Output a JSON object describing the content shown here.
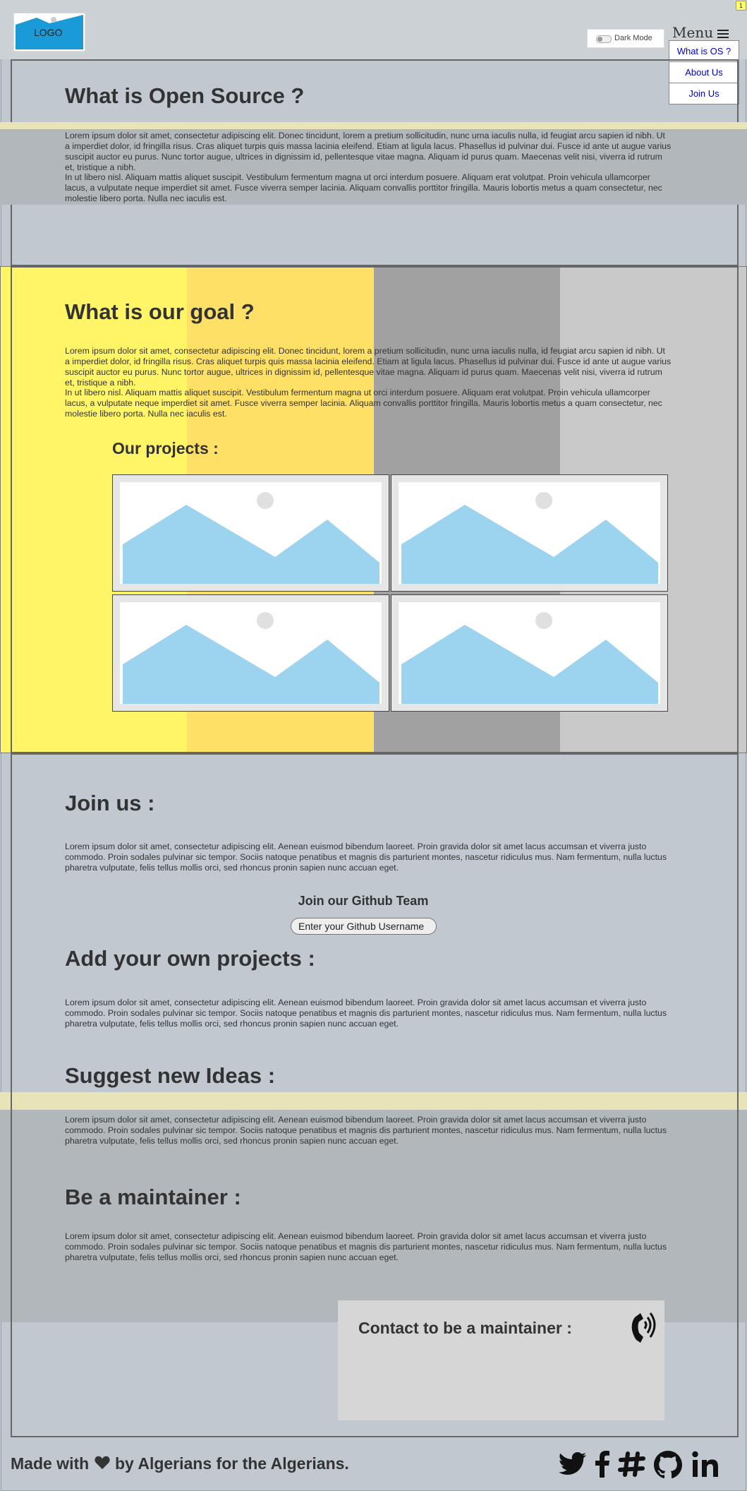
{
  "header": {
    "logo_text": "LOGO",
    "dark_mode_label": "Dark Mode",
    "menu_label": "Menu",
    "menu_items": [
      "What is OS ?",
      "About Us",
      "Join Us"
    ],
    "page_badge": "1"
  },
  "sections": {
    "what_is_os": {
      "title": "What is Open Source ?",
      "p1": "Lorem ipsum dolor sit amet, consectetur adipiscing elit. Donec tincidunt, lorem a pretium sollicitudin, nunc urna iaculis nulla, id feugiat arcu sapien id nibh. Ut a imperdiet dolor, id fringilla risus. Cras aliquet turpis quis massa lacinia eleifend. Etiam at ligula lacus. Phasellus id pulvinar dui. Fusce id ante ut augue varius suscipit auctor eu purus. Nunc tortor augue, ultrices in dignissim id, pellentesque vitae magna. Aliquam id purus quam. Maecenas velit nisi, viverra id rutrum et, tristique a nibh.",
      "p2": "In ut libero nisl. Aliquam mattis aliquet suscipit. Vestibulum fermentum magna ut orci interdum posuere. Aliquam erat volutpat. Proin vehicula ullamcorper lacus, a vulputate neque imperdiet sit amet. Fusce viverra semper lacinia. Aliquam convallis porttitor fringilla. Mauris lobortis metus a quam consectetur, nec molestie libero porta. Nulla nec iaculis est."
    },
    "goal": {
      "title": "What is our goal ?",
      "p1": "Lorem ipsum dolor sit amet, consectetur adipiscing elit. Donec tincidunt, lorem a pretium sollicitudin, nunc urna iaculis nulla, id feugiat arcu sapien id nibh. Ut a imperdiet dolor, id fringilla risus. Cras aliquet turpis quis massa lacinia eleifend. Etiam at ligula lacus. Phasellus id pulvinar dui. Fusce id ante ut augue varius suscipit auctor eu purus. Nunc tortor augue, ultrices in dignissim id, pellentesque vitae magna. Aliquam id purus quam. Maecenas velit nisi, viverra id rutrum et, tristique a nibh.",
      "p2": "In ut libero nisl. Aliquam mattis aliquet suscipit. Vestibulum fermentum magna ut orci interdum posuere. Aliquam erat volutpat. Proin vehicula ullamcorper lacus, a vulputate neque imperdiet sit amet. Fusce viverra semper lacinia. Aliquam convallis porttitor fringilla. Mauris lobortis metus a quam consectetur, nec molestie libero porta. Nulla nec iaculis est.",
      "projects_title": "Our projects :"
    },
    "join": {
      "title": "Join us :",
      "p": "Lorem ipsum dolor sit amet, consectetur adipiscing elit. Aenean euismod bibendum laoreet. Proin gravida dolor sit amet lacus accumsan et viverra justo commodo. Proin sodales pulvinar sic tempor. Sociis natoque penatibus et magnis dis parturient montes, nascetur ridiculus mus. Nam fermentum, nulla luctus pharetra vulputate, felis tellus mollis orci, sed rhoncus pronin sapien nunc accuan eget.",
      "github_title": "Join our Github Team",
      "github_placeholder": "Enter your Github Username"
    },
    "add_projects": {
      "title": "Add your own projects :",
      "p": "Lorem ipsum dolor sit amet, consectetur adipiscing elit. Aenean euismod bibendum laoreet. Proin gravida dolor sit amet lacus accumsan et viverra justo commodo. Proin sodales pulvinar sic tempor. Sociis natoque penatibus et magnis dis parturient montes, nascetur ridiculus mus. Nam fermentum, nulla luctus pharetra vulputate, felis tellus mollis orci, sed rhoncus pronin sapien nunc accuan eget."
    },
    "ideas": {
      "title": "Suggest new Ideas :",
      "p": "Lorem ipsum dolor sit amet, consectetur adipiscing elit. Aenean euismod bibendum laoreet. Proin gravida dolor sit amet lacus accumsan et viverra justo commodo. Proin sodales pulvinar sic tempor. Sociis natoque penatibus et magnis dis parturient montes, nascetur ridiculus mus. Nam fermentum, nulla luctus pharetra vulputate, felis tellus mollis orci, sed rhoncus pronin sapien nunc accuan eget."
    },
    "maintainer": {
      "title": "Be a maintainer :",
      "p": "Lorem ipsum dolor sit amet, consectetur adipiscing elit. Aenean euismod bibendum laoreet. Proin gravida dolor sit amet lacus accumsan et viverra justo commodo. Proin sodales pulvinar sic tempor. Sociis natoque penatibus et magnis dis parturient montes, nascetur ridiculus mus. Nam fermentum, nulla luctus pharetra vulputate, felis tellus mollis orci, sed rhoncus pronin sapien nunc accuan eget.",
      "contact_title": "Contact to be a maintainer :",
      "contact_icon": "phone-ringing-icon"
    }
  },
  "footer": {
    "made_with": "Made with",
    "by_text": "by Algerians for the Algerians.",
    "heart_icon": "heart-icon",
    "social_icons": [
      "twitter-icon",
      "facebook-icon",
      "slack-icon",
      "github-icon",
      "linkedin-icon"
    ]
  },
  "colors": {
    "page_bg": "#c1c8d0",
    "menu_link": "#0000cc",
    "yellow": "#fff566",
    "yellow2": "#ffe066",
    "gray_dark": "#a1a1a1",
    "gray_light": "#c9c9c9",
    "image_sky": "#9cd3ee"
  }
}
